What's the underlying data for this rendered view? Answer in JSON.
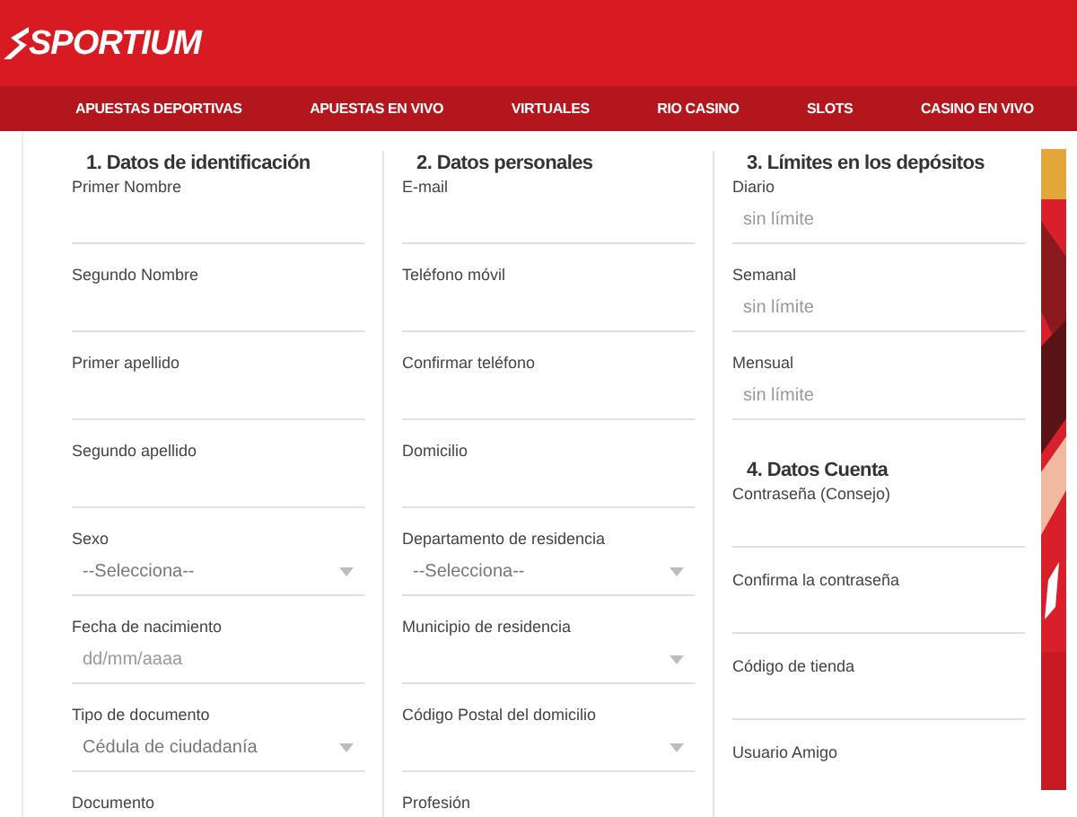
{
  "header": {
    "logo": "SPORTIUM"
  },
  "nav": [
    {
      "label": "APUESTAS DEPORTIVAS"
    },
    {
      "label": "APUESTAS EN VIVO"
    },
    {
      "label": "VIRTUALES"
    },
    {
      "label": "RIO CASINO"
    },
    {
      "label": "SLOTS"
    },
    {
      "label": "CASINO EN VIVO"
    }
  ],
  "columns": [
    {
      "sections": [
        {
          "title": "1. Datos de identificación",
          "fields": [
            {
              "kind": "text",
              "label": "Primer Nombre"
            },
            {
              "kind": "text",
              "label": "Segundo Nombre"
            },
            {
              "kind": "text",
              "label": "Primer apellido"
            },
            {
              "kind": "text",
              "label": "Segundo apellido"
            },
            {
              "kind": "select",
              "label": "Sexo",
              "value": "--Selecciona--"
            },
            {
              "kind": "text",
              "label": "Fecha de nacimiento",
              "placeholder": "dd/mm/aaaa"
            },
            {
              "kind": "select",
              "label": "Tipo de documento",
              "value": "Cédula de ciudadanía"
            },
            {
              "kind": "text",
              "label": "Documento"
            }
          ]
        }
      ]
    },
    {
      "sections": [
        {
          "title": "2. Datos personales",
          "fields": [
            {
              "kind": "text",
              "label": "E-mail"
            },
            {
              "kind": "text",
              "label": "Teléfono móvil"
            },
            {
              "kind": "text",
              "label": "Confirmar teléfono"
            },
            {
              "kind": "text",
              "label": "Domicilio"
            },
            {
              "kind": "select",
              "label": "Departamento de residencia",
              "value": "--Selecciona--"
            },
            {
              "kind": "select",
              "label": "Municipio de residencia"
            },
            {
              "kind": "select",
              "label": "Código Postal del domicilio"
            },
            {
              "kind": "text",
              "label": "Profesión"
            }
          ]
        }
      ]
    },
    {
      "sections": [
        {
          "title": "3. Límites en los depósitos",
          "fields": [
            {
              "kind": "text",
              "label": "Diario",
              "placeholder": "sin límite"
            },
            {
              "kind": "text",
              "label": "Semanal",
              "placeholder": "sin límite"
            },
            {
              "kind": "text",
              "label": "Mensual",
              "placeholder": "sin límite"
            }
          ]
        },
        {
          "title": "4. Datos Cuenta",
          "fields": [
            {
              "kind": "password",
              "label": "Contraseña (Consejo)"
            },
            {
              "kind": "password",
              "label": "Confirma la contraseña"
            },
            {
              "kind": "password",
              "label": "Código de tienda"
            },
            {
              "kind": "password",
              "label": "Usuario Amigo"
            }
          ]
        }
      ]
    }
  ]
}
